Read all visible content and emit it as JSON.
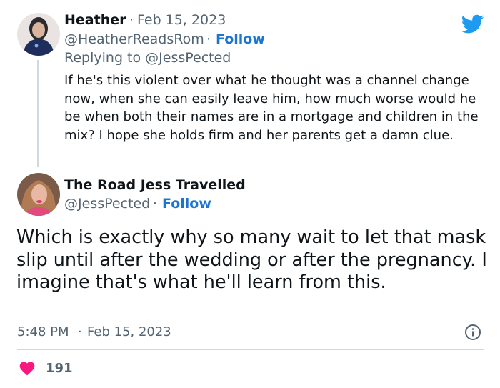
{
  "reply_tweet": {
    "author_name": "Heather",
    "separator": "·",
    "date": "Feb 15, 2023",
    "handle": "@HeatherReadsRom",
    "follow_label": "Follow",
    "replying_to": "Replying to @JessPected",
    "text": "If he's this violent over what he thought was a channel change now, when she can easily leave him, how much worse would he be when both their names are in a mortgage and children in the mix? I hope she holds firm and her parents get a damn clue."
  },
  "main_tweet": {
    "author_name": "The Road Jess Travelled",
    "handle": "@JessPected",
    "separator": "·",
    "follow_label": "Follow",
    "text": "Which is exactly why so many wait to let that mask slip until after the wedding or after the pregnancy. I imagine that's what he'll learn from this.",
    "time": "5:48 PM",
    "date": "Feb 15, 2023",
    "likes": "191"
  },
  "colors": {
    "accent": "#1d9bf0",
    "follow": "#1d75d2",
    "secondary_text": "#536471",
    "heart": "#f91880"
  },
  "icons": {
    "brand": "twitter-bird-icon",
    "info": "info-icon",
    "like": "heart-icon"
  }
}
